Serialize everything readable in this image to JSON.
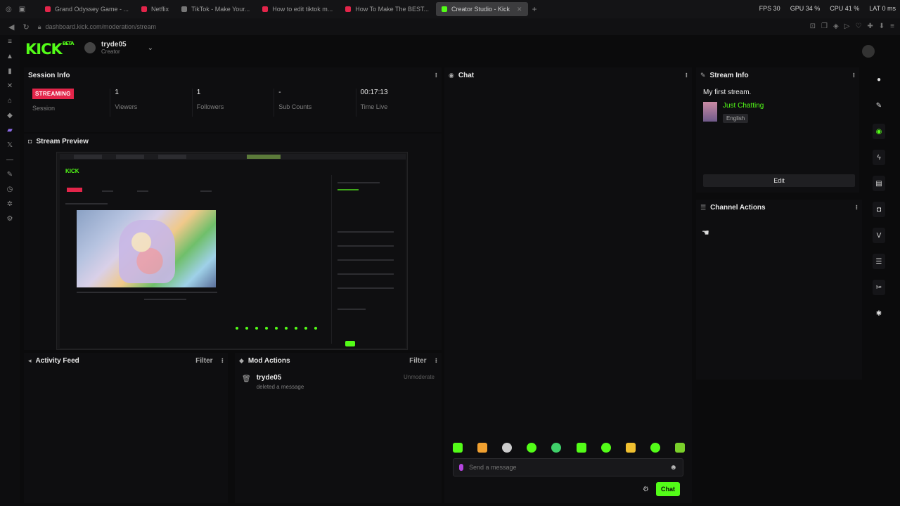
{
  "browser": {
    "tabs": [
      {
        "label": "Grand Odyssey Game - ...",
        "color": "#e3254a",
        "active": false
      },
      {
        "label": "Netflix",
        "color": "#e3254a",
        "active": false
      },
      {
        "label": "TikTok - Make Your...",
        "color": "#777777",
        "active": false
      },
      {
        "label": "How to edit tiktok m...",
        "color": "#e3254a",
        "active": false
      },
      {
        "label": "How To Make The BEST...",
        "color": "#e3254a",
        "active": false
      },
      {
        "label": "Creator Studio - Kick",
        "color": "#53fc18",
        "active": true
      }
    ],
    "newtab_icon": "plus-icon",
    "url": "dashboard.kick.com/moderation/stream",
    "perf": {
      "fps_label": "FPS",
      "fps": "30",
      "gpu_label": "GPU",
      "gpu": "34 %",
      "cpu_label": "CPU",
      "cpu": "41 %",
      "lat_label": "LAT",
      "lat": "0 ms"
    }
  },
  "header": {
    "logo": "KICK",
    "logo_sup": "BETA",
    "channel_name": "tryde05",
    "channel_role": "Creator"
  },
  "session_info": {
    "title": "Session Info",
    "status_badge": "STREAMING",
    "status_label": "Session",
    "stats": [
      {
        "value": "1",
        "label": "Viewers"
      },
      {
        "value": "1",
        "label": "Followers"
      },
      {
        "value": "-",
        "label": "Sub Counts"
      },
      {
        "value": "00:17:13",
        "label": "Time Live"
      }
    ]
  },
  "stream_preview": {
    "title": "Stream Preview",
    "preview_logo": "KICK"
  },
  "activity_feed": {
    "title": "Activity Feed",
    "filter_label": "Filter"
  },
  "mod_actions": {
    "title": "Mod Actions",
    "filter_label": "Filter",
    "items": [
      {
        "user": "tryde05",
        "action": "deleted a message",
        "tag": "Unmoderate"
      }
    ]
  },
  "chat": {
    "title": "Chat",
    "input_placeholder": "Send a message",
    "send_label": "Chat",
    "emote_colors": [
      "#53fc18",
      "#f0a030",
      "#cccccc",
      "#53fc18",
      "#3fd06a",
      "#53fc18",
      "#53fc18",
      "#f0c030",
      "#53fc18",
      "#7ad02a"
    ]
  },
  "stream_info": {
    "title": "Stream Info",
    "stream_title": "My first stream.",
    "category": "Just Chatting",
    "language": "English",
    "edit_label": "Edit"
  },
  "channel_actions": {
    "title": "Channel Actions"
  },
  "colors": {
    "accent": "#53fc18",
    "live": "#e3254a",
    "panel": "#0e0e10",
    "background": "#0b0b0c"
  }
}
